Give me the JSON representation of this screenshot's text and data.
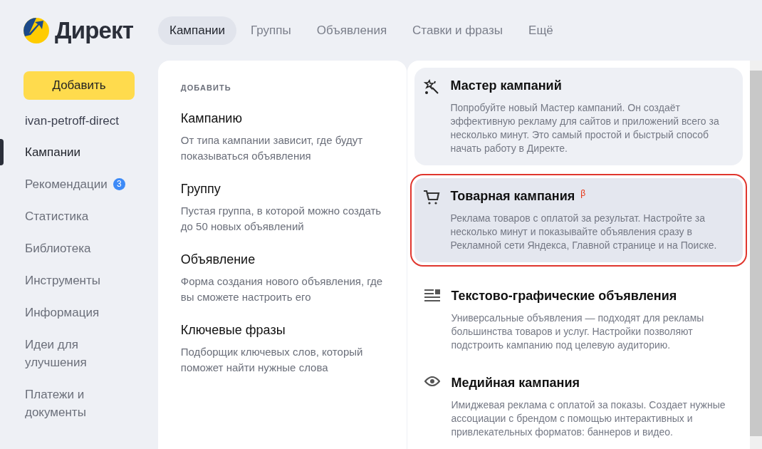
{
  "logo": {
    "text": "Директ"
  },
  "tabs": [
    {
      "label": "Кампании",
      "selected": true
    },
    {
      "label": "Группы",
      "selected": false
    },
    {
      "label": "Объявления",
      "selected": false
    },
    {
      "label": "Ставки и фразы",
      "selected": false
    },
    {
      "label": "Ещё",
      "selected": false
    }
  ],
  "add_button": "Добавить",
  "account": "ivan-petroff-direct",
  "sidebar": {
    "items": [
      {
        "label": "Кампании",
        "selected": true
      },
      {
        "label": "Рекомендации",
        "selected": false,
        "badge": "3"
      },
      {
        "label": "Статистика",
        "selected": false
      },
      {
        "label": "Библиотека",
        "selected": false
      },
      {
        "label": "Инструменты",
        "selected": false
      },
      {
        "label": "Информация",
        "selected": false
      },
      {
        "label": "Идеи для улучшения",
        "selected": false
      },
      {
        "label": "Платежи и документы",
        "selected": false
      }
    ]
  },
  "add_menu": {
    "heading": "ДОБАВИТЬ",
    "items": [
      {
        "title": "Кампанию",
        "description": "От типа кампании зависит, где будут показываться объявления"
      },
      {
        "title": "Группу",
        "description": "Пустая группа, в которой можно создать до 50 новых объявлений"
      },
      {
        "title": "Объявление",
        "description": "Форма создания нового объявления, где вы сможете настроить его"
      },
      {
        "title": "Ключевые фразы",
        "description": "Подборщик ключевых слов, который поможет найти нужные слова"
      }
    ]
  },
  "campaign_types": [
    {
      "kind": "wizard",
      "title": "Мастер кампаний",
      "description": "Попробуйте новый Мастер кампаний. Он создаёт эффективную рекламу для сайтов и приложений всего за несколько минут. Это самый простой и быстрый способ начать работу в Директе.",
      "shaded": true,
      "selected": false
    },
    {
      "kind": "product",
      "title": "Товарная кампания",
      "mark": "β",
      "description": "Реклама товаров с оплатой за результат. Настройте за несколько минут и показывайте объявления сразу в Рекламной сети Яндекса, Главной странице и на Поиске.",
      "shaded": true,
      "selected": true
    },
    {
      "kind": "text",
      "title": "Текстово-графические объявления",
      "description": "Универсальные объявления — подходят для рекламы большинства товаров и услуг. Настройки позволяют подстроить кампанию под целевую аудиторию.",
      "shaded": false,
      "selected": false
    },
    {
      "kind": "media",
      "title": "Медийная кампания",
      "description": "Имиджевая реклама с оплатой за показы. Создает нужные ассоциации с брендом с помощью интерактивных и привлекательных форматов: баннеров и видео.",
      "shaded": false,
      "selected": false
    }
  ]
}
